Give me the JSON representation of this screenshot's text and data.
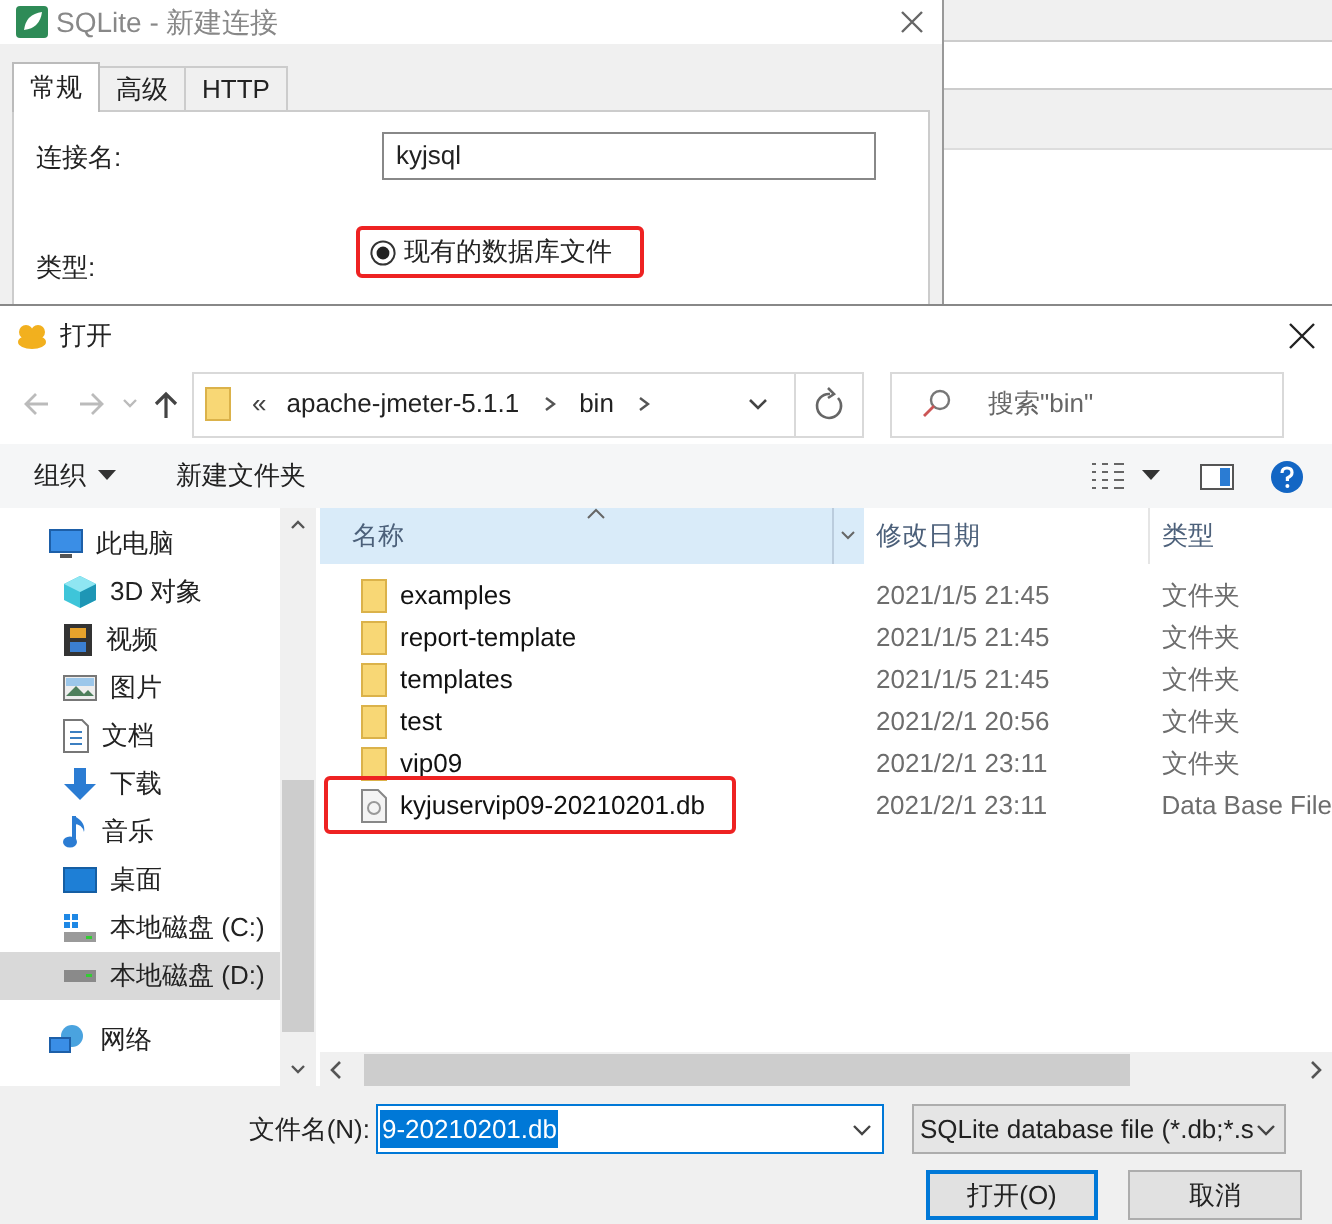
{
  "connection_dialog": {
    "title": "SQLite - 新建连接",
    "tabs": [
      {
        "label": "常规",
        "selected": true
      },
      {
        "label": "高级",
        "selected": false
      },
      {
        "label": "HTTP",
        "selected": false
      }
    ],
    "name_label": "连接名:",
    "name_value": "kyjsql",
    "type_label": "类型:",
    "type_option": {
      "label": "现有的数据库文件",
      "selected": true,
      "annotated": true
    }
  },
  "open_dialog": {
    "title": "打开",
    "address": {
      "overflow": "«",
      "segments": [
        "apache-jmeter-5.1.1",
        "bin"
      ]
    },
    "search": {
      "placeholder": "搜索\"bin\""
    },
    "toolbar": {
      "organize": "组织",
      "new_folder": "新建文件夹"
    },
    "nav": [
      {
        "label": "此电脑",
        "kind": "computer",
        "selected": false,
        "children": [
          {
            "label": "3D 对象",
            "kind": "cube",
            "selected": false
          },
          {
            "label": "视频",
            "kind": "video",
            "selected": false
          },
          {
            "label": "图片",
            "kind": "picture",
            "selected": false
          },
          {
            "label": "文档",
            "kind": "document",
            "selected": false
          },
          {
            "label": "下载",
            "kind": "download",
            "selected": false
          },
          {
            "label": "音乐",
            "kind": "music",
            "selected": false
          },
          {
            "label": "桌面",
            "kind": "desktop",
            "selected": false
          },
          {
            "label": "本地磁盘 (C:)",
            "kind": "system-drive",
            "selected": false
          },
          {
            "label": "本地磁盘 (D:)",
            "kind": "drive",
            "selected": true
          }
        ]
      },
      {
        "label": "网络",
        "kind": "network",
        "selected": false
      }
    ],
    "columns": [
      "名称",
      "修改日期",
      "类型"
    ],
    "files": [
      {
        "name": "examples",
        "date": "2021/1/5 21:45",
        "type": "文件夹",
        "kind": "folder",
        "annotated": false
      },
      {
        "name": "report-template",
        "date": "2021/1/5 21:45",
        "type": "文件夹",
        "kind": "folder",
        "annotated": false
      },
      {
        "name": "templates",
        "date": "2021/1/5 21:45",
        "type": "文件夹",
        "kind": "folder",
        "annotated": false
      },
      {
        "name": "test",
        "date": "2021/2/1 20:56",
        "type": "文件夹",
        "kind": "folder",
        "annotated": false
      },
      {
        "name": "vip09",
        "date": "2021/2/1 23:11",
        "type": "文件夹",
        "kind": "folder",
        "annotated": false
      },
      {
        "name": "kyjuservip09-20210201.db",
        "date": "2021/2/1 23:11",
        "type": "Data Base File",
        "kind": "file",
        "annotated": true
      }
    ],
    "filename_label": "文件名(N):",
    "filename_value": "9-20210201.db",
    "filetype": "SQLite database file (*.db;*.s",
    "open_button": "打开(O)",
    "cancel_button": "取消"
  }
}
